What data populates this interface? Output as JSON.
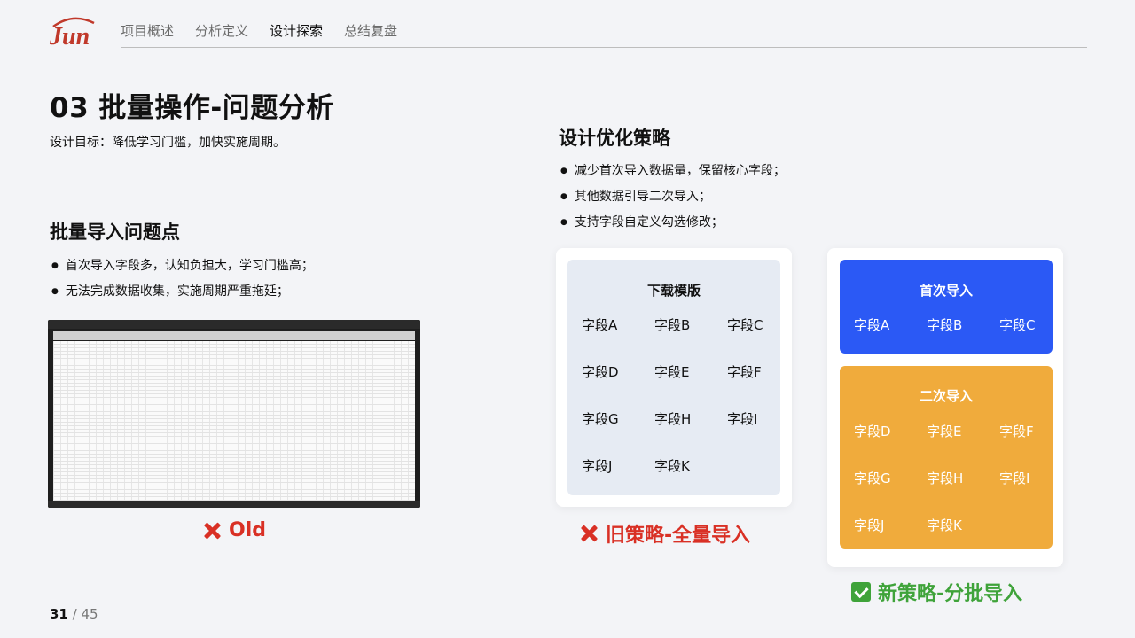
{
  "header": {
    "logo_text": "Jun",
    "nav": [
      {
        "label": "项目概述",
        "active": false
      },
      {
        "label": "分析定义",
        "active": false
      },
      {
        "label": "设计探索",
        "active": true
      },
      {
        "label": "总结复盘",
        "active": false
      }
    ]
  },
  "title": "03 批量操作-问题分析",
  "subtitle": "设计目标：降低学习门槛，加快实施周期。",
  "problems": {
    "title": "批量导入问题点",
    "items": [
      "首次导入字段多，认知负担大，学习门槛高；",
      "无法完成数据收集，实施周期严重拖延；"
    ]
  },
  "old_label": "Old",
  "strategy": {
    "title": "设计优化策略",
    "items": [
      "减少首次导入数据量，保留核心字段；",
      "其他数据引导二次导入；",
      "支持字段自定义勾选修改；"
    ]
  },
  "old_card": {
    "title": "下载模版",
    "fields": [
      "字段A",
      "字段B",
      "字段C",
      "字段D",
      "字段E",
      "字段F",
      "字段G",
      "字段H",
      "字段I",
      "字段J",
      "字段K"
    ],
    "caption": "旧策略-全量导入"
  },
  "new_card": {
    "first": {
      "title": "首次导入",
      "fields": [
        "字段A",
        "字段B",
        "字段C"
      ]
    },
    "second": {
      "title": "二次导入",
      "fields": [
        "字段D",
        "字段E",
        "字段F",
        "字段G",
        "字段H",
        "字段I",
        "字段J",
        "字段K"
      ]
    },
    "caption": "新策略-分批导入"
  },
  "pager": {
    "current": "31",
    "separator": "/",
    "total": "45"
  },
  "colors": {
    "blue": "#2b59f5",
    "orange": "#f0ab3c",
    "old_card_bg": "#e6ebf3",
    "red": "#d93025",
    "green": "#3fa33a"
  },
  "icons": {
    "x": "cross-mark-icon",
    "check": "check-mark-icon"
  }
}
